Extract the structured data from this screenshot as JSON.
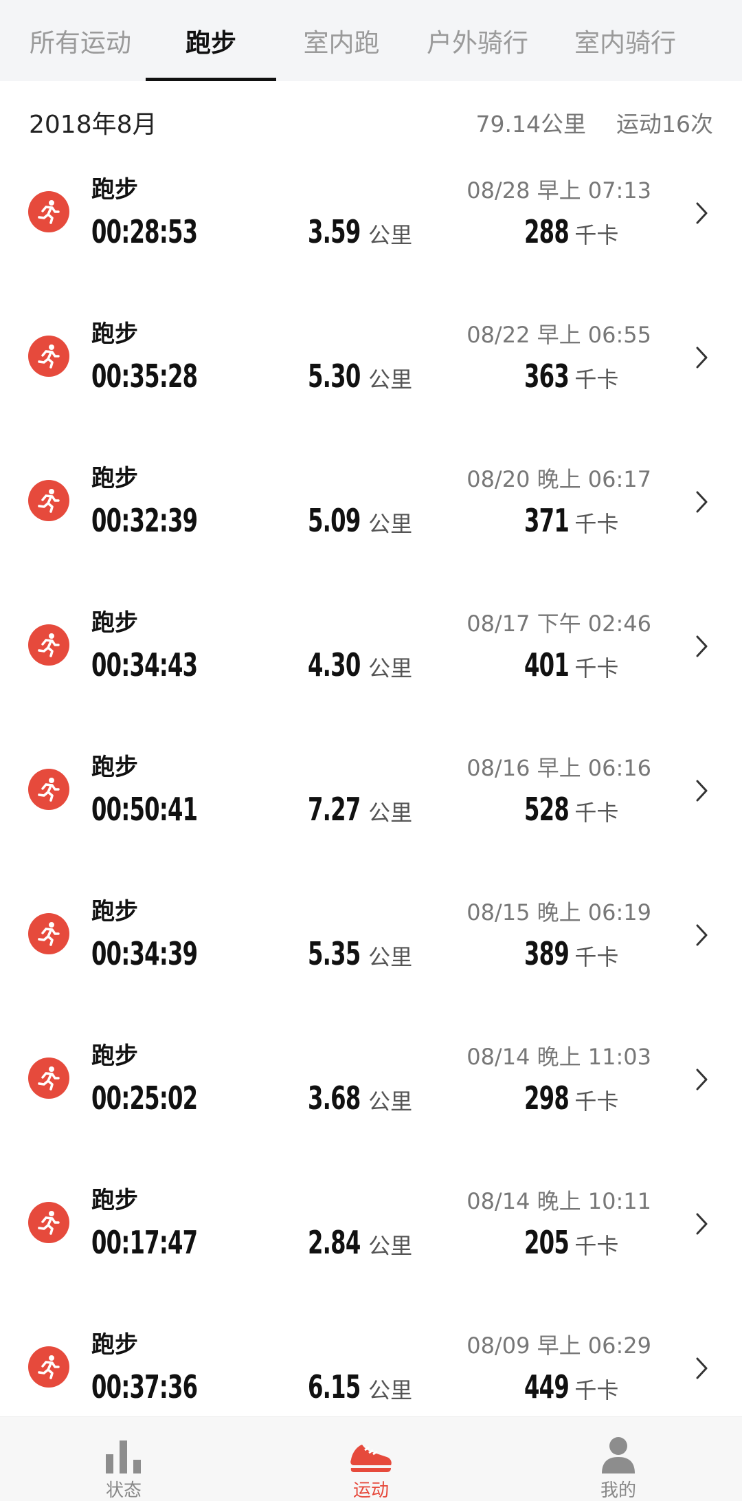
{
  "tabs": [
    {
      "label": "所有运动",
      "active": false
    },
    {
      "label": "跑步",
      "active": true
    },
    {
      "label": "室内跑",
      "active": false
    },
    {
      "label": "户外骑行",
      "active": false
    },
    {
      "label": "室内骑行",
      "active": false
    }
  ],
  "summary": {
    "month": "2018年8月",
    "total_distance": "79.14公里",
    "count": "运动16次"
  },
  "units": {
    "distance": "公里",
    "calories": "千卡"
  },
  "records": [
    {
      "type": "跑步",
      "datetime": "08/28 早上 07:13",
      "duration": "00:28:53",
      "distance": "3.59",
      "calories": "288"
    },
    {
      "type": "跑步",
      "datetime": "08/22 早上 06:55",
      "duration": "00:35:28",
      "distance": "5.30",
      "calories": "363"
    },
    {
      "type": "跑步",
      "datetime": "08/20 晚上 06:17",
      "duration": "00:32:39",
      "distance": "5.09",
      "calories": "371"
    },
    {
      "type": "跑步",
      "datetime": "08/17 下午 02:46",
      "duration": "00:34:43",
      "distance": "4.30",
      "calories": "401"
    },
    {
      "type": "跑步",
      "datetime": "08/16 早上 06:16",
      "duration": "00:50:41",
      "distance": "7.27",
      "calories": "528"
    },
    {
      "type": "跑步",
      "datetime": "08/15 晚上 06:19",
      "duration": "00:34:39",
      "distance": "5.35",
      "calories": "389"
    },
    {
      "type": "跑步",
      "datetime": "08/14 晚上 11:03",
      "duration": "00:25:02",
      "distance": "3.68",
      "calories": "298"
    },
    {
      "type": "跑步",
      "datetime": "08/14 晚上 10:11",
      "duration": "00:17:47",
      "distance": "2.84",
      "calories": "205"
    },
    {
      "type": "跑步",
      "datetime": "08/09 早上 06:29",
      "duration": "00:37:36",
      "distance": "6.15",
      "calories": "449"
    }
  ],
  "bottom_nav": [
    {
      "label": "状态",
      "icon": "bar-chart-icon",
      "active": false
    },
    {
      "label": "运动",
      "icon": "running-shoe-icon",
      "active": true
    },
    {
      "label": "我的",
      "icon": "person-icon",
      "active": false
    }
  ],
  "colors": {
    "accent": "#e64a3c",
    "tab_bg": "#f4f5f7",
    "muted": "#9a9a9a"
  }
}
